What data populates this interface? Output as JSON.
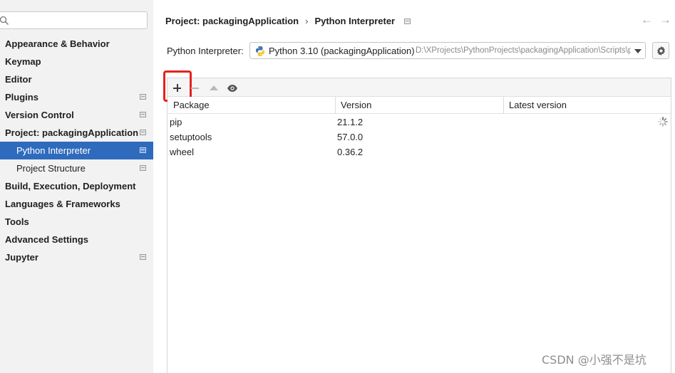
{
  "sidebar": {
    "search_placeholder": "",
    "items": [
      {
        "label": "Appearance & Behavior"
      },
      {
        "label": "Keymap"
      },
      {
        "label": "Editor"
      },
      {
        "label": "Plugins"
      },
      {
        "label": "Version Control"
      },
      {
        "label": "Project: packagingApplication"
      },
      {
        "label": "Python Interpreter"
      },
      {
        "label": "Project Structure"
      },
      {
        "label": "Build, Execution, Deployment"
      },
      {
        "label": "Languages & Frameworks"
      },
      {
        "label": "Tools"
      },
      {
        "label": "Advanced Settings"
      },
      {
        "label": "Jupyter"
      }
    ]
  },
  "breadcrumb": {
    "project": "Project: packagingApplication",
    "separator": "›",
    "page": "Python Interpreter"
  },
  "nav": {
    "back": "←",
    "forward": "→"
  },
  "interpreter": {
    "label": "Python Interpreter:",
    "name": "Python 3.10 (packagingApplication)",
    "path": "D:\\XProjects\\PythonProjects\\packagingApplication\\Scripts\\python.exe"
  },
  "table": {
    "columns": [
      "Package",
      "Version",
      "Latest version"
    ],
    "rows": [
      {
        "package": "pip",
        "version": "21.1.2",
        "latest": ""
      },
      {
        "package": "setuptools",
        "version": "57.0.0",
        "latest": ""
      },
      {
        "package": "wheel",
        "version": "0.36.2",
        "latest": ""
      }
    ]
  },
  "watermark": "CSDN @小强不是坑",
  "colors": {
    "selection": "#2f6bbd",
    "highlight_box": "#e8211d",
    "sidebar_bg": "#f2f2f2"
  },
  "icons": {
    "search": "search-icon",
    "python": "python-icon",
    "settings": "gear-icon",
    "add": "plus-icon",
    "remove": "minus-icon",
    "upgrade": "arrow-up-icon",
    "show_early": "eye-icon",
    "loading": "spinner-icon"
  }
}
